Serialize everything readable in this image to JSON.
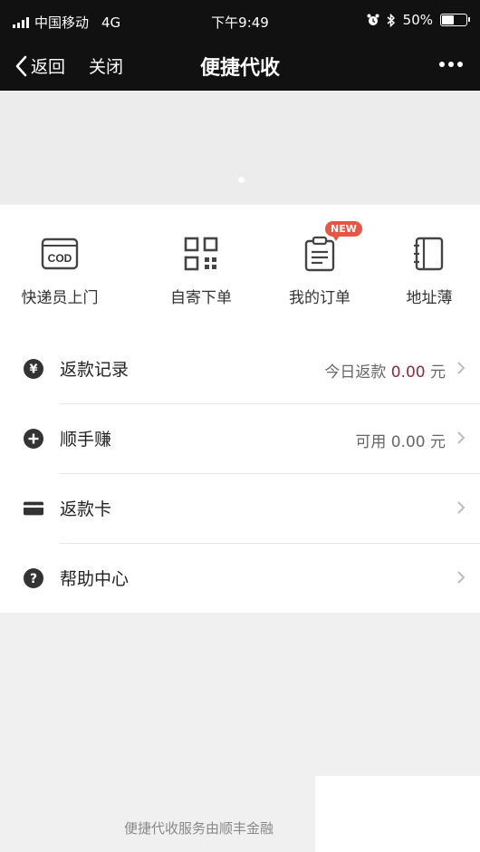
{
  "status_bar": {
    "carrier": "中国移动",
    "network": "4G",
    "time": "下午9:49",
    "battery": "50%",
    "battery_level": 0.5
  },
  "nav": {
    "back_label": "返回",
    "close_label": "关闭",
    "title": "便捷代收"
  },
  "grid": {
    "items": [
      {
        "label": "快递员上门",
        "icon": "cod-icon"
      },
      {
        "label": "自寄下单",
        "icon": "qr-code-icon"
      },
      {
        "label": "我的订单",
        "icon": "clipboard-icon",
        "badge": "NEW"
      },
      {
        "label": "地址薄",
        "icon": "address-book-icon"
      }
    ],
    "cod_text": "COD"
  },
  "list": {
    "refund_records": {
      "title": "返款记录",
      "prefix": "今日返款",
      "amount": "0.00",
      "unit": "元",
      "icon": "yen-icon"
    },
    "shunshouzhuan": {
      "title": "顺手赚",
      "prefix": "可用",
      "amount": "0.00",
      "unit": "元",
      "icon": "plus-icon"
    },
    "refund_card": {
      "title": "返款卡",
      "icon": "card-icon"
    },
    "help_center": {
      "title": "帮助中心",
      "icon": "help-icon"
    },
    "yen_symbol": "¥",
    "help_symbol": "?"
  },
  "footer": {
    "text": "便捷代收服务由顺丰金融"
  },
  "colors": {
    "bar_bg": "#111111",
    "accent_amount": "#8a2c3c",
    "badge": "#e95545"
  }
}
